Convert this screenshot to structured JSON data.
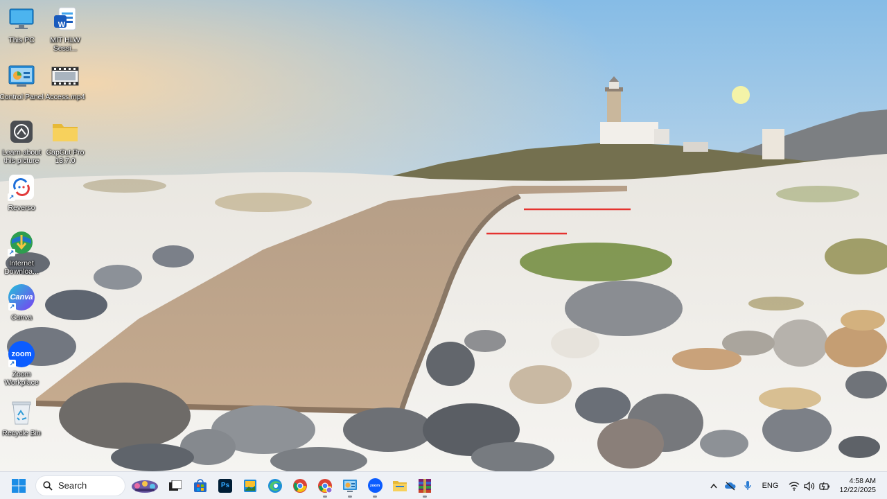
{
  "desktop": {
    "icons": [
      {
        "label": "This PC",
        "icon": "monitor-icon"
      },
      {
        "label": "MIT HLW Sessi...",
        "icon": "word-doc-icon"
      },
      {
        "label": "Control Panel",
        "icon": "control-panel-icon"
      },
      {
        "label": "Access.mp4",
        "icon": "video-file-icon"
      },
      {
        "label": "Learn about this picture",
        "icon": "camera-icon"
      },
      {
        "label": "CapCut Pro 13.7.0",
        "icon": "folder-icon"
      },
      {
        "label": "Reverso",
        "icon": "reverso-icon"
      },
      {
        "label": "Internet Downloa...",
        "icon": "internet-download-manager-icon"
      },
      {
        "label": "Canva",
        "icon": "canva-icon",
        "glyph_text": "Canva"
      },
      {
        "label": "Zoom Workplace",
        "icon": "zoom-icon",
        "glyph_text": "zoom"
      },
      {
        "label": "Recycle Bin",
        "icon": "recycle-bin-icon"
      }
    ],
    "word_badge": "W"
  },
  "taskbar": {
    "search_label": "Search",
    "apps": [
      {
        "name": "task-view",
        "icon": "task-view-icon"
      },
      {
        "name": "microsoft-store",
        "icon": "store-icon"
      },
      {
        "name": "photoshop",
        "icon": "photoshop-icon",
        "glyph_text": "Ps"
      },
      {
        "name": "gallery",
        "icon": "gallery-icon"
      },
      {
        "name": "edge",
        "icon": "edge-icon"
      },
      {
        "name": "chrome",
        "icon": "chrome-icon"
      },
      {
        "name": "chrome-profile",
        "icon": "chrome-profile-icon"
      },
      {
        "name": "control-panel",
        "icon": "control-panel-icon"
      },
      {
        "name": "zoom",
        "icon": "zoom-icon",
        "glyph_text": "zoom"
      },
      {
        "name": "file-explorer",
        "icon": "folder-icon"
      },
      {
        "name": "winrar",
        "icon": "winrar-icon"
      }
    ],
    "tray": {
      "language": "ENG",
      "time": "4:58 AM",
      "date": "12/22/2025"
    }
  }
}
